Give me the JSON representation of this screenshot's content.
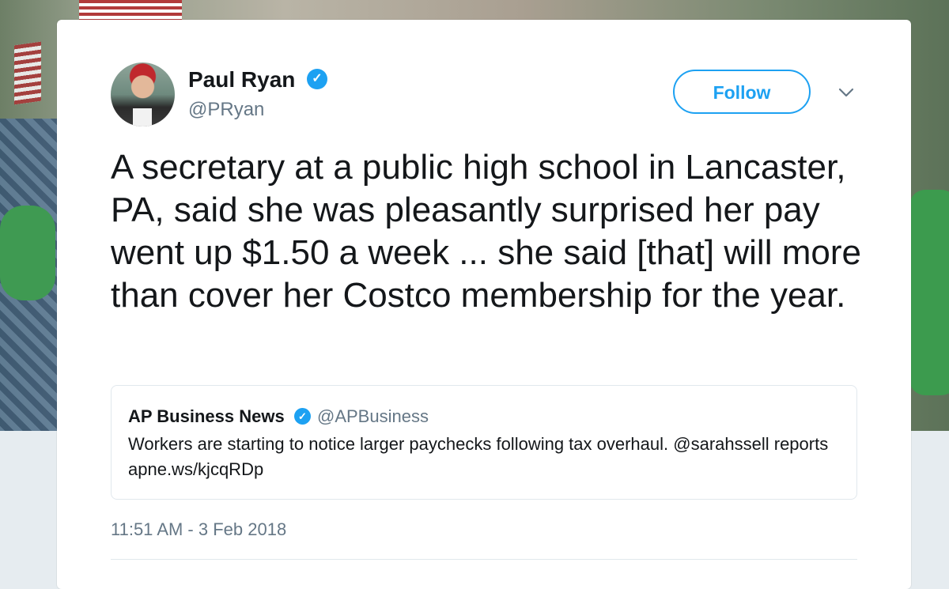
{
  "author": {
    "name": "Paul Ryan",
    "handle": "@PRyan",
    "verified": true
  },
  "actions": {
    "follow_label": "Follow",
    "menu_icon": "chevron-down-icon"
  },
  "tweet": {
    "text": "A secretary at a public high school in Lancaster, PA, said she was pleasantly surprised her pay went up $1.50 a week ... she said [that] will more than cover her Costco membership for the year.",
    "timestamp": "11:51 AM - 3 Feb 2018"
  },
  "quoted_tweet": {
    "name": "AP Business News",
    "handle": "@APBusiness",
    "verified": true,
    "text": "Workers are starting to notice larger paychecks following tax overhaul. @sarahssell reports apne.ws/kjcqRDp"
  },
  "colors": {
    "accent": "#1da1f2",
    "text_primary": "#14171a",
    "text_secondary": "#657786",
    "border": "#e1e8ed"
  }
}
